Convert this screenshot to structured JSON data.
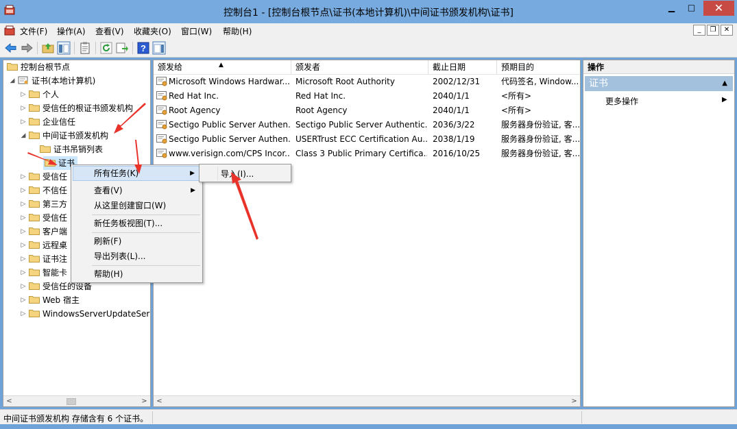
{
  "window": {
    "title": "控制台1 - [控制台根节点\\证书(本地计算机)\\中间证书颁发机构\\证书]",
    "minimize_glyph": "▁",
    "maximize_glyph": "□",
    "close_glyph": "✕"
  },
  "menu": {
    "items": [
      "文件(F)",
      "操作(A)",
      "查看(V)",
      "收藏夹(O)",
      "窗口(W)",
      "帮助(H)"
    ],
    "mdi": [
      "_",
      "❐",
      "✕"
    ]
  },
  "tree": {
    "root": "控制台根节点",
    "store": "证书(本地计算机)",
    "nodes": [
      "个人",
      "受信任的根证书颁发机构",
      "企业信任",
      "中间证书颁发机构",
      "证书吊销列表",
      "证书",
      "受信任",
      "不信任",
      "第三方",
      "受信任",
      "客户端",
      "远程桌",
      "证书注",
      "智能卡",
      "受信任的设备",
      "Web 宿主",
      "WindowsServerUpdateSer"
    ]
  },
  "list": {
    "sort_indicator": "▲",
    "columns": [
      "颁发给",
      "颁发者",
      "截止日期",
      "预期目的"
    ],
    "rows": [
      [
        "Microsoft Windows Hardwar...",
        "Microsoft Root Authority",
        "2002/12/31",
        "代码签名, Window..."
      ],
      [
        "Red Hat Inc.",
        "Red Hat Inc.",
        "2040/1/1",
        "<所有>"
      ],
      [
        "Root Agency",
        "Root Agency",
        "2040/1/1",
        "<所有>"
      ],
      [
        "Sectigo Public Server Authen...",
        "Sectigo Public Server Authentic...",
        "2036/3/22",
        "服务器身份验证, 客..."
      ],
      [
        "Sectigo Public Server Authen...",
        "USERTrust ECC Certification Au...",
        "2038/1/19",
        "服务器身份验证, 客..."
      ],
      [
        "www.verisign.com/CPS Incor...",
        "Class 3 Public Primary Certifica...",
        "2016/10/25",
        "服务器身份验证, 客..."
      ]
    ]
  },
  "actions": {
    "title": "操作",
    "section": "证书",
    "collapse_glyph": "▲",
    "more": "更多操作",
    "more_arrow": "▶"
  },
  "context_menu": {
    "items": [
      "所有任务(K)",
      "查看(V)",
      "从这里创建窗口(W)",
      "新任务板视图(T)...",
      "刷新(F)",
      "导出列表(L)...",
      "帮助(H)"
    ],
    "submenu_arrow": "▶",
    "submenu": [
      "导入(I)..."
    ]
  },
  "status": {
    "text": "中间证书颁发机构 存储含有 6 个证书。"
  },
  "scroll": {
    "left": "<",
    "right": ">"
  },
  "colors": {
    "titlebar": "#77abdf",
    "close": "#c74a44",
    "selection": "#cce8ff",
    "action_section": "#a3c1dd",
    "annotation_arrow": "#e8322a"
  }
}
